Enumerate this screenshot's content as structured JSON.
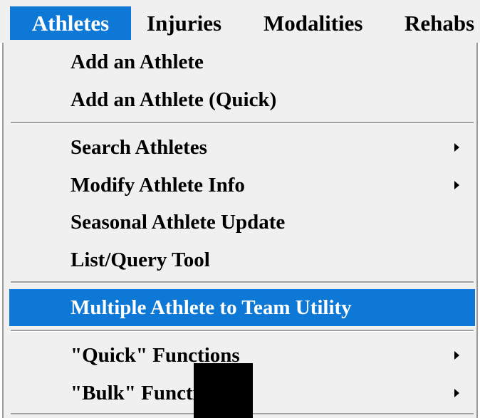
{
  "menubar": {
    "items": [
      {
        "label": "Athletes"
      },
      {
        "label": "Injuries"
      },
      {
        "label": "Modalities"
      },
      {
        "label": "Rehabs"
      }
    ]
  },
  "dropdown": {
    "items": [
      {
        "label": "Add an Athlete"
      },
      {
        "label": "Add an Athlete (Quick)"
      },
      {
        "label": "Search Athletes",
        "submenu_icon": "submenu-arrow-icon"
      },
      {
        "label": "Modify Athlete Info",
        "submenu_icon": "submenu-arrow-icon"
      },
      {
        "label": "Seasonal Athlete Update"
      },
      {
        "label": "List/Query Tool"
      },
      {
        "label": "Multiple Athlete to Team Utility",
        "highlighted": true
      },
      {
        "label": "\"Quick\" Functions",
        "submenu_icon": "submenu-arrow-icon"
      },
      {
        "label": "\"Bulk\" Functions",
        "submenu_icon": "submenu-arrow-icon"
      }
    ]
  },
  "colors": {
    "highlight": "#0d78d6",
    "menu_background": "#f0f0f0"
  }
}
